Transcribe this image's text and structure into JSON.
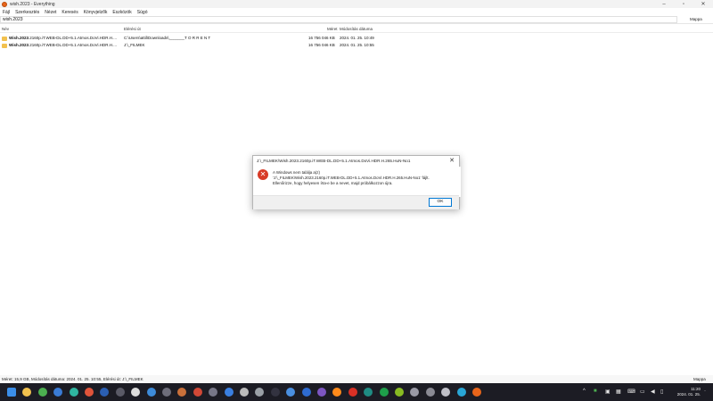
{
  "window": {
    "title": "wish.2023 - Everything"
  },
  "menu": [
    "Fájl",
    "Szerkesztés",
    "Nézet",
    "Keresés",
    "Könyvjelzők",
    "Eszközök",
    "Súgó"
  ],
  "search": {
    "value": "wish.2023",
    "filter": "Mappa"
  },
  "columns": {
    "name": "Név",
    "path": "Elérési út",
    "size": "Méret",
    "modified": "Módosítás dátuma"
  },
  "rows": [
    {
      "name_bold": "Wish.2023",
      "name_rest": ".2160p.iT.WEB-DL.DD+5.1.Atmos.DoVi.HDR.H....",
      "path": "C:\\Users\\attil\\Downloads\\_______T O R R E N T",
      "size": "16 756 046 KB",
      "modified": "2024. 01. 25. 10:49"
    },
    {
      "name_bold": "Wish.2023",
      "name_rest": ".2160p.iT.WEB-DL.DD+5.1.Atmos.DoVi.HDR.H....",
      "path": "J:\\_FILMEK",
      "size": "16 756 046 KB",
      "modified": "2024. 01. 25. 10:55"
    }
  ],
  "status": {
    "left": "Méret: 15,9 GB, Módosítás dátuma: 2024. 01. 25. 10:55, Elérési út: J:\\_FILMEK",
    "right": "Mappa"
  },
  "dialog": {
    "title": "J:\\_FILMEK\\Wish.2023.2160p.iT.WEB-DL.DD+5.1.Atmos.DoVi.HDR.H.265.HuN-No1",
    "line1": "A Windows nem találja a(z)",
    "line2": "'J:\\_FILMEK\\Wish.2023.2160p.iT.WEB-DL.DD+5.1.Atmos.DoVi.HDR.H.265.HuN-No1' fájlt.",
    "line3": "Ellenőrizze, hogy helyesen írta-e be a nevet, majd próbálkozzon újra.",
    "ok_label": "OK"
  },
  "clock": {
    "time": "11:20",
    "date": "2024. 01. 25."
  },
  "taskbar_icons": [
    {
      "name": "start-icon",
      "color": "#3b8ee8"
    },
    {
      "name": "file-explorer-icon",
      "color": "#f2c14e"
    },
    {
      "name": "chrome-icon",
      "color": "#4caf50"
    },
    {
      "name": "store-icon",
      "color": "#3a7bd5"
    },
    {
      "name": "edge-icon",
      "color": "#2fb5a0"
    },
    {
      "name": "browser-icon",
      "color": "#e0543a"
    },
    {
      "name": "word-icon",
      "color": "#2b5fb3"
    },
    {
      "name": "calculator-icon",
      "color": "#5a5a66"
    },
    {
      "name": "search-app-icon",
      "color": "#dddddd"
    },
    {
      "name": "mail-icon",
      "color": "#3d8bd9"
    },
    {
      "name": "photos-icon",
      "color": "#6d6d7a"
    },
    {
      "name": "settings-app-icon",
      "color": "#c9703a"
    },
    {
      "name": "tool-icon",
      "color": "#d14836"
    },
    {
      "name": "media-icon",
      "color": "#777788"
    },
    {
      "name": "app-blue-icon",
      "color": "#3a7fe0"
    },
    {
      "name": "app-dot-icon",
      "color": "#bbbbbb"
    },
    {
      "name": "pen-icon",
      "color": "#9aa0a6"
    },
    {
      "name": "terminal-icon",
      "color": "#333340"
    },
    {
      "name": "gear-icon",
      "color": "#4a8fe0"
    },
    {
      "name": "blue-app-icon",
      "color": "#2e6bd0"
    },
    {
      "name": "viber-icon",
      "color": "#7d56c2"
    },
    {
      "name": "firefox-icon",
      "color": "#ff8a1a"
    },
    {
      "name": "red-app-icon",
      "color": "#d93025"
    },
    {
      "name": "teal-app-icon",
      "color": "#1f8c83"
    },
    {
      "name": "green-app-icon",
      "color": "#1e9e4a"
    },
    {
      "name": "game-icon",
      "color": "#88bb22"
    },
    {
      "name": "grey-app-icon",
      "color": "#9a9aa6"
    },
    {
      "name": "chat-icon",
      "color": "#8a8a94"
    },
    {
      "name": "circle-app-icon",
      "color": "#c0c0c8"
    },
    {
      "name": "cyan-app-icon",
      "color": "#29a6d6"
    },
    {
      "name": "everything-icon",
      "color": "#e8651a"
    }
  ]
}
